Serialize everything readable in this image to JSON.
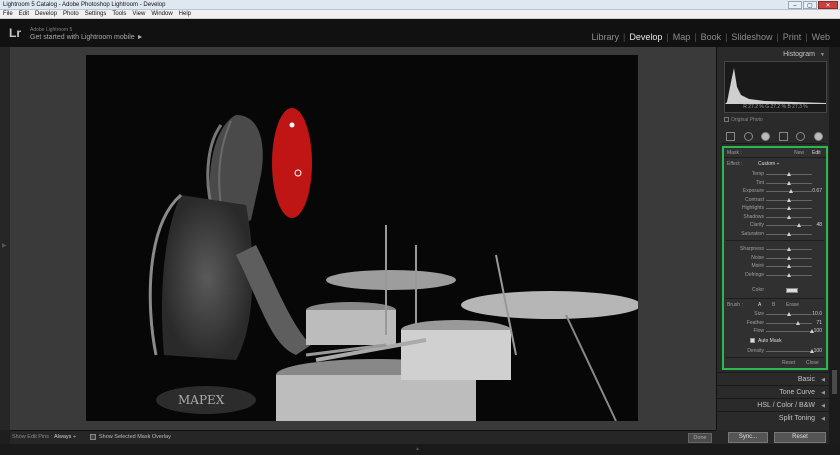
{
  "window": {
    "title": "Lightroom 5 Catalog - Adobe Photoshop Lightroom - Develop",
    "controls": [
      "–",
      "▢",
      "✕"
    ]
  },
  "menu": [
    "File",
    "Edit",
    "Develop",
    "Photo",
    "Settings",
    "Tools",
    "View",
    "Window",
    "Help"
  ],
  "identity": {
    "logo": "Lr",
    "subtitle": "Adobe Lightroom 5",
    "main": "Get started with Lightroom mobile ►"
  },
  "modules": [
    {
      "label": "Library",
      "active": false
    },
    {
      "label": "Develop",
      "active": true
    },
    {
      "label": "Map",
      "active": false
    },
    {
      "label": "Book",
      "active": false
    },
    {
      "label": "Slideshow",
      "active": false
    },
    {
      "label": "Print",
      "active": false
    },
    {
      "label": "Web",
      "active": false
    }
  ],
  "histogram": {
    "title": "Histogram",
    "readout": "R  27.2  %   G  27.2  %   B  27.3  %",
    "original_photo": "Original Photo"
  },
  "brush_panel": {
    "mask_label": "Mask :",
    "mask_new": "New",
    "mask_edit": "Edit",
    "effect_label": "Effect :",
    "effect_value": "Custom ÷",
    "sliders_top": [
      {
        "label": "Temp",
        "pos": 0.5,
        "value": ""
      },
      {
        "label": "Tint",
        "pos": 0.5,
        "value": ""
      },
      {
        "label": "Exposure",
        "pos": 0.55,
        "value": "0.67"
      },
      {
        "label": "Contrast",
        "pos": 0.5,
        "value": ""
      },
      {
        "label": "Highlights",
        "pos": 0.5,
        "value": ""
      },
      {
        "label": "Shadows",
        "pos": 0.5,
        "value": ""
      },
      {
        "label": "Clarity",
        "pos": 0.72,
        "value": "48"
      },
      {
        "label": "Saturation",
        "pos": 0.5,
        "value": ""
      }
    ],
    "sliders_mid": [
      {
        "label": "Sharpness",
        "pos": 0.5,
        "value": ""
      },
      {
        "label": "Noise",
        "pos": 0.5,
        "value": ""
      },
      {
        "label": "Moiré",
        "pos": 0.5,
        "value": ""
      },
      {
        "label": "Defringe",
        "pos": 0.5,
        "value": ""
      }
    ],
    "color_label": "Color",
    "brush_label": "Brush :",
    "brush_a": "A",
    "brush_b": "B",
    "brush_erase": "Erase",
    "sliders_brush": [
      {
        "label": "Size",
        "pos": 0.5,
        "value": "10.0"
      },
      {
        "label": "Feather",
        "pos": 0.7,
        "value": "71"
      },
      {
        "label": "Flow",
        "pos": 1.0,
        "value": "100"
      }
    ],
    "auto_mask": "Auto Mask",
    "density": {
      "label": "Density",
      "pos": 1.0,
      "value": "100"
    },
    "reset": "Reset",
    "close": "Close"
  },
  "sections": [
    {
      "label": "Basic"
    },
    {
      "label": "Tone Curve"
    },
    {
      "label": "HSL  /  Color  /  B&W"
    },
    {
      "label": "Split Toning"
    }
  ],
  "bottom_buttons": {
    "sync": "Sync...",
    "reset": "Reset"
  },
  "toolbar": {
    "show_edit_pins_label": "Show Edit Pins :",
    "show_edit_pins_value": "Always ÷",
    "overlay_label": "Show Selected Mask Overlay",
    "done": "Done"
  }
}
